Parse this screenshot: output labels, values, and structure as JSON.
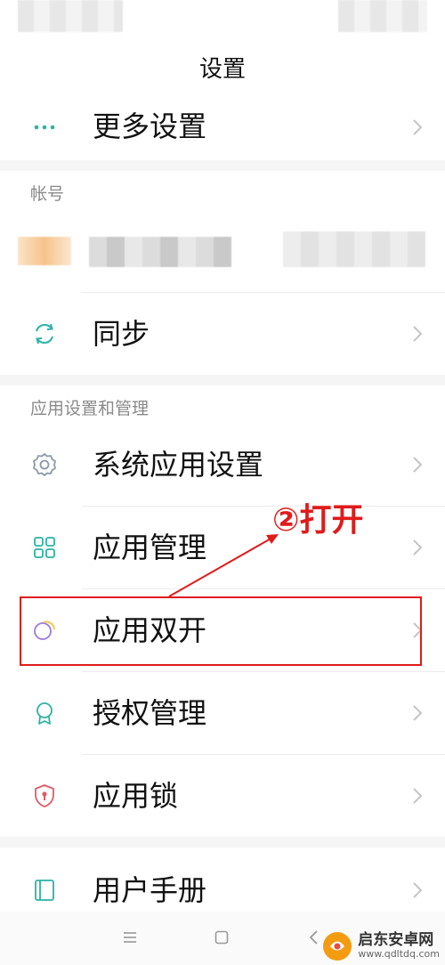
{
  "title": "设置",
  "rows": {
    "more_settings": "更多设置",
    "sync": "同步",
    "system_app_settings": "系统应用设置",
    "app_management": "应用管理",
    "dual_apps": "应用双开",
    "permission_management": "授权管理",
    "app_lock": "应用锁",
    "user_manual": "用户手册"
  },
  "sections": {
    "account": "帐号",
    "app_settings": "应用设置和管理"
  },
  "annotation": {
    "text": "②打开",
    "color": "#e01b1b"
  },
  "watermark": {
    "title": "启东安卓网",
    "url": "www.qdltdq.com"
  },
  "colors": {
    "accent_teal": "#2ab3a6",
    "dual_purple": "#9b7be0",
    "dual_yellow": "#f4c84a",
    "lock_red": "#e35a6a"
  }
}
